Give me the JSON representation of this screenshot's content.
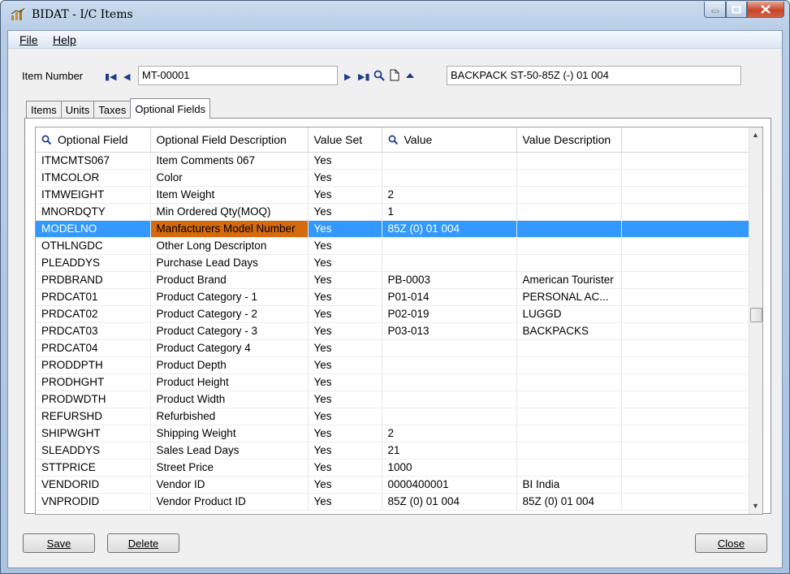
{
  "window": {
    "title": "BIDAT - I/C Items",
    "controls": [
      "minimize-icon",
      "maximize-icon",
      "close-icon"
    ]
  },
  "menu": {
    "file": "File",
    "help": "Help"
  },
  "item": {
    "label": "Item Number",
    "number": "MT-00001",
    "description": "BACKPACK ST-50-85Z (-) 01 004"
  },
  "tabs": [
    {
      "label": "Items",
      "active": false
    },
    {
      "label": "Units",
      "active": false
    },
    {
      "label": "Taxes",
      "active": false
    },
    {
      "label": "Optional Fields",
      "active": true
    }
  ],
  "grid": {
    "columns": [
      "Optional Field",
      "Optional Field Description",
      "Value Set",
      "Value",
      "Value Description"
    ],
    "selected_row": 4,
    "rows": [
      [
        "ITMCMTS067",
        "Item Comments 067",
        "Yes",
        "",
        ""
      ],
      [
        "ITMCOLOR",
        "Color",
        "Yes",
        "",
        ""
      ],
      [
        "ITMWEIGHT",
        "Item Weight",
        "Yes",
        "2",
        ""
      ],
      [
        "MNORDQTY",
        "Min Ordered Qty(MOQ)",
        "Yes",
        "1",
        ""
      ],
      [
        "MODELNO",
        "Manfacturers Model Number",
        "Yes",
        "85Z (0) 01 004",
        ""
      ],
      [
        "OTHLNGDC",
        "Other Long Descripton",
        "Yes",
        "",
        ""
      ],
      [
        "PLEADDYS",
        "Purchase Lead Days",
        "Yes",
        "",
        ""
      ],
      [
        "PRDBRAND",
        "Product Brand",
        "Yes",
        "PB-0003",
        "American Tourister"
      ],
      [
        "PRDCAT01",
        "Product Category - 1",
        "Yes",
        "P01-014",
        "PERSONAL AC..."
      ],
      [
        "PRDCAT02",
        "Product Category - 2",
        "Yes",
        "P02-019",
        "LUGGD"
      ],
      [
        "PRDCAT03",
        "Product Category - 3",
        "Yes",
        "P03-013",
        "BACKPACKS"
      ],
      [
        "PRDCAT04",
        "Product Category 4",
        "Yes",
        "",
        ""
      ],
      [
        "PRODDPTH",
        "Product Depth",
        "Yes",
        "",
        ""
      ],
      [
        "PRODHGHT",
        "Product Height",
        "Yes",
        "",
        ""
      ],
      [
        "PRODWDTH",
        "Product Width",
        "Yes",
        "",
        ""
      ],
      [
        "REFURSHD",
        "Refurbished",
        "Yes",
        "",
        ""
      ],
      [
        "SHIPWGHT",
        "Shipping Weight",
        "Yes",
        "2",
        ""
      ],
      [
        "SLEADDYS",
        "Sales Lead Days",
        "Yes",
        "21",
        ""
      ],
      [
        "STTPRICE",
        "Street Price",
        "Yes",
        "1000",
        ""
      ],
      [
        "VENDORID",
        "Vendor ID",
        "Yes",
        "0000400001",
        "BI India"
      ],
      [
        "VNPRODID",
        "Vendor Product ID",
        "Yes",
        "85Z (0) 01 004",
        "85Z (0) 01 004"
      ]
    ]
  },
  "buttons": {
    "save": "Save",
    "delete": "Delete",
    "close": "Close"
  }
}
